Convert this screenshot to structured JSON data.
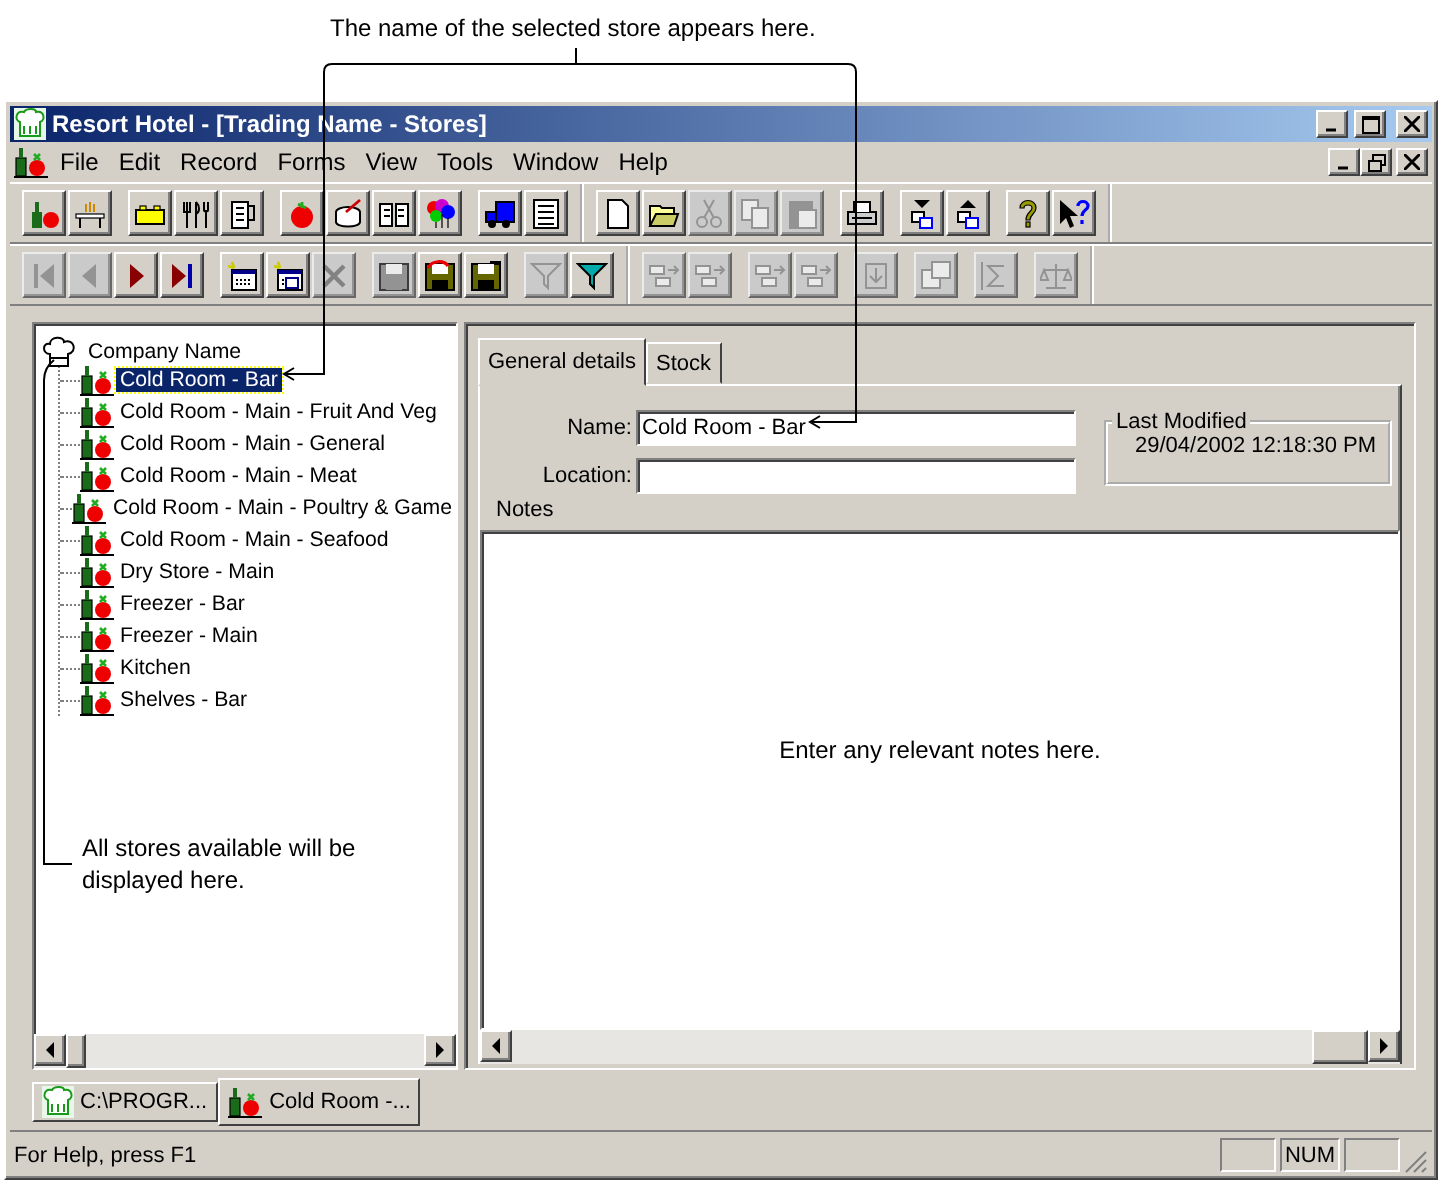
{
  "callouts": {
    "top": "The name of the selected store appears here.",
    "tree": "All stores available will be displayed here."
  },
  "window": {
    "title": "Resort Hotel - [Trading Name - Stores]"
  },
  "menu": [
    "File",
    "Edit",
    "Record",
    "Forms",
    "View",
    "Tools",
    "Window",
    "Help"
  ],
  "toolbars": [
    [
      [
        [
          {
            "kind": "bottle-apple",
            "disabled": false
          },
          {
            "kind": "table",
            "disabled": false
          }
        ],
        [
          {
            "kind": "brick",
            "disabled": false
          },
          {
            "kind": "cutlery",
            "disabled": false
          },
          {
            "kind": "jug",
            "disabled": false
          }
        ],
        [
          {
            "kind": "tomato",
            "disabled": false
          },
          {
            "kind": "pot",
            "disabled": false
          },
          {
            "kind": "book",
            "disabled": false
          },
          {
            "kind": "balloons",
            "disabled": false
          }
        ],
        [
          {
            "kind": "truck",
            "disabled": false
          },
          {
            "kind": "form",
            "disabled": false
          }
        ]
      ],
      [
        [
          {
            "kind": "new-document",
            "disabled": false
          },
          {
            "kind": "folder",
            "disabled": false
          },
          {
            "kind": "scissors",
            "disabled": true
          },
          {
            "kind": "copy",
            "disabled": true
          },
          {
            "kind": "paste",
            "disabled": true
          }
        ],
        [
          {
            "kind": "printer",
            "disabled": false
          }
        ],
        [
          {
            "kind": "window-down",
            "disabled": false
          },
          {
            "kind": "window-up",
            "disabled": false
          }
        ],
        [
          {
            "kind": "help",
            "disabled": false
          },
          {
            "kind": "help-pointer",
            "disabled": false
          }
        ]
      ]
    ],
    [
      [
        [
          {
            "kind": "first",
            "disabled": true
          },
          {
            "kind": "previous",
            "disabled": true
          },
          {
            "kind": "next",
            "disabled": false
          },
          {
            "kind": "last",
            "disabled": false
          }
        ],
        [
          {
            "kind": "new-record",
            "disabled": false
          },
          {
            "kind": "copy-record",
            "disabled": false
          },
          {
            "kind": "delete",
            "disabled": true
          }
        ],
        [
          {
            "kind": "save",
            "disabled": true
          },
          {
            "kind": "save-refresh",
            "disabled": false
          },
          {
            "kind": "save-as",
            "disabled": false
          }
        ],
        [
          {
            "kind": "filter",
            "disabled": true
          },
          {
            "kind": "filter",
            "disabled": false
          }
        ]
      ],
      [
        [
          {
            "kind": "move-left",
            "disabled": true
          },
          {
            "kind": "move-right",
            "disabled": true
          }
        ],
        [
          {
            "kind": "move-up",
            "disabled": true
          },
          {
            "kind": "move-down",
            "disabled": true
          }
        ],
        [
          {
            "kind": "export",
            "disabled": true
          }
        ],
        [
          {
            "kind": "windows",
            "disabled": true
          }
        ],
        [
          {
            "kind": "sum",
            "disabled": true
          }
        ],
        [
          {
            "kind": "scales",
            "disabled": true
          }
        ]
      ]
    ]
  ],
  "tree": {
    "label": "Company Name",
    "expanded": true,
    "children": [
      {
        "label": "Cold Room - Bar",
        "selected": true
      },
      {
        "label": "Cold Room - Main - Fruit And Veg",
        "selected": false
      },
      {
        "label": "Cold Room - Main - General",
        "selected": false
      },
      {
        "label": "Cold Room - Main - Meat",
        "selected": false
      },
      {
        "label": "Cold Room - Main - Poultry & Game",
        "selected": false
      },
      {
        "label": "Cold Room - Main - Seafood",
        "selected": false
      },
      {
        "label": "Dry Store - Main",
        "selected": false
      },
      {
        "label": "Freezer - Bar",
        "selected": false
      },
      {
        "label": "Freezer - Main",
        "selected": false
      },
      {
        "label": "Kitchen",
        "selected": false
      },
      {
        "label": "Shelves - Bar",
        "selected": false
      }
    ]
  },
  "tabs": [
    {
      "label": "General details",
      "selected": true
    },
    {
      "label": "Stock",
      "selected": false
    }
  ],
  "form": {
    "name_label": "Name:",
    "name_value": "Cold Room - Bar",
    "location_label": "Location:",
    "last_modified_label": "Last Modified",
    "last_modified": "29/04/2002 12:18:30 PM",
    "notes_label": "Notes",
    "notes_text": "Enter any relevant notes here."
  },
  "window_tabs": [
    {
      "label": "C:\\PROGR...",
      "kind": "app",
      "selected": false
    },
    {
      "label": "Cold Room -...",
      "kind": "store",
      "selected": true
    }
  ],
  "status_bar": {
    "text": "For Help, press F1",
    "indicator": "NUM"
  }
}
